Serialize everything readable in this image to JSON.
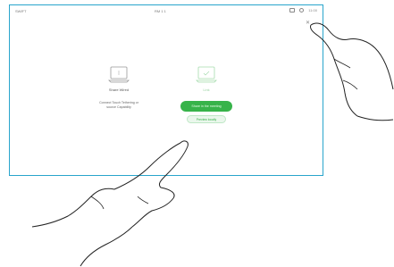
{
  "topbar": {
    "left_text": "SWIFT",
    "center_text": "RM 1 1",
    "time": "11:00",
    "icons": [
      "camera-icon",
      "person-icon"
    ]
  },
  "content": {
    "left": {
      "label": "Share Wired",
      "hint_line1": "Connect Touch Tethering or",
      "hint_line2": "source Capability"
    },
    "right": {
      "label": "Link",
      "share_button": "Share in the meeting",
      "secondary_button": "Preview locally"
    }
  },
  "colors": {
    "accent_border": "#29a5cc",
    "primary_button": "#37b34a"
  }
}
